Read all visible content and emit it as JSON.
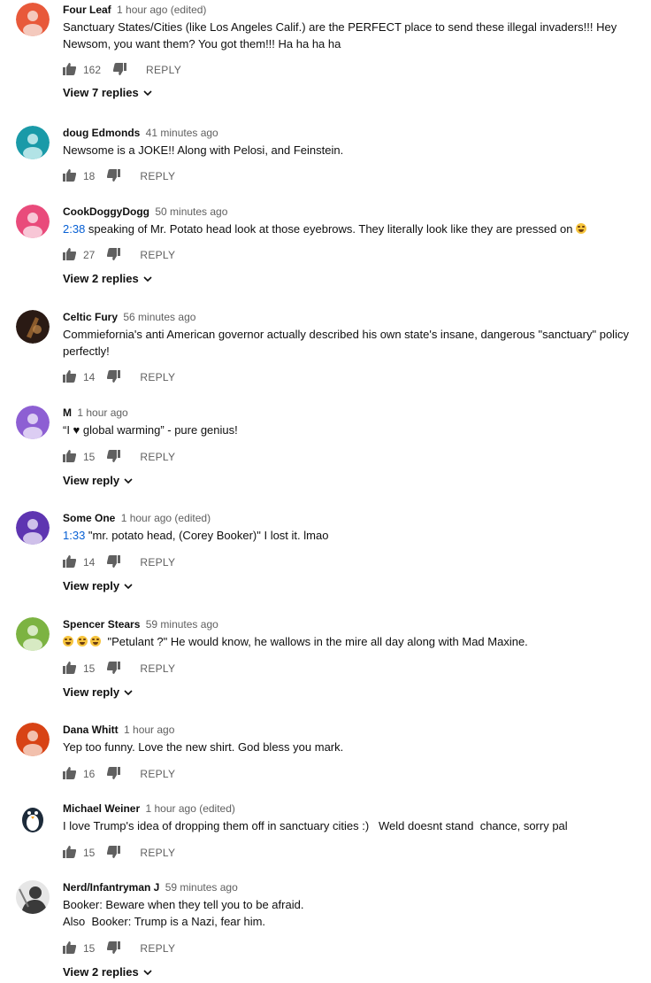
{
  "comments": [
    {
      "author": "Four Leaf",
      "time": "1 hour ago (edited)",
      "text": "Sanctuary States/Cities (like Los Angeles Calif.) are the PERFECT place to send these illegal invaders!!! Hey Newsom, you want them? You got them!!! Ha ha ha ha",
      "likes": "162",
      "reply": "REPLY",
      "replies_label": "View 7 replies",
      "avatar_color": "#e8593a"
    },
    {
      "author": "doug Edmonds",
      "time": "41 minutes ago",
      "text": "Newsome is a JOKE!! Along with Pelosi, and Feinstein.",
      "likes": "18",
      "reply": "REPLY",
      "avatar_color": "#1a9aa8"
    },
    {
      "author": "CookDoggyDogg",
      "time": "50 minutes ago",
      "timestamp_link": "2:38",
      "text": " speaking of Mr. Potato head look at those eyebrows. They literally look like they are pressed on",
      "likes": "27",
      "reply": "REPLY",
      "replies_label": "View 2 replies",
      "avatar_color": "#e94b7b"
    },
    {
      "author": "Celtic Fury",
      "time": "56 minutes ago",
      "text": "Commiefornia's anti American governor actually described his own state's insane, dangerous \"sanctuary\" policy perfectly!",
      "likes": "14",
      "reply": "REPLY",
      "avatar_color": "#2a1a14"
    },
    {
      "author": "M",
      "time": "1 hour ago",
      "text": "“I ♥ global warming” - pure genius!",
      "likes": "15",
      "reply": "REPLY",
      "replies_label": "View reply",
      "avatar_color": "#8d5fd3"
    },
    {
      "author": "Some One",
      "time": "1 hour ago (edited)",
      "timestamp_link": "1:33",
      "text": " \"mr. potato head, (Corey Booker)\" I lost it. lmao",
      "likes": "14",
      "reply": "REPLY",
      "replies_label": "View reply",
      "avatar_color": "#5e35b1"
    },
    {
      "author": "Spencer Stears",
      "time": "59 minutes ago",
      "text": "\"Petulant ?\" He would know, he wallows in the mire all day along with Mad Maxine.",
      "likes": "15",
      "reply": "REPLY",
      "replies_label": "View reply",
      "avatar_color": "#7cb342"
    },
    {
      "author": "Dana Whitt",
      "time": "1 hour ago",
      "text": "Yep too funny. Love the new shirt. God bless you mark.",
      "likes": "16",
      "reply": "REPLY",
      "avatar_color": "#d84315"
    },
    {
      "author": "Michael Weiner",
      "time": "1 hour ago (edited)",
      "text": "I love Trump's idea of dropping them off in sanctuary cities :)   Weld doesnt stand  chance, sorry pal",
      "likes": "15",
      "reply": "REPLY",
      "avatar_color": "#1d2b3a"
    },
    {
      "author": "Nerd/Infantryman J",
      "time": "59 minutes ago",
      "text_lines": [
        "Booker: Beware when they tell you to be afraid.",
        "Also  Booker: Trump is a Nazi, fear him."
      ],
      "likes": "15",
      "reply": "REPLY",
      "replies_label": "View 2 replies",
      "avatar_color": "#3a3a3a"
    }
  ]
}
